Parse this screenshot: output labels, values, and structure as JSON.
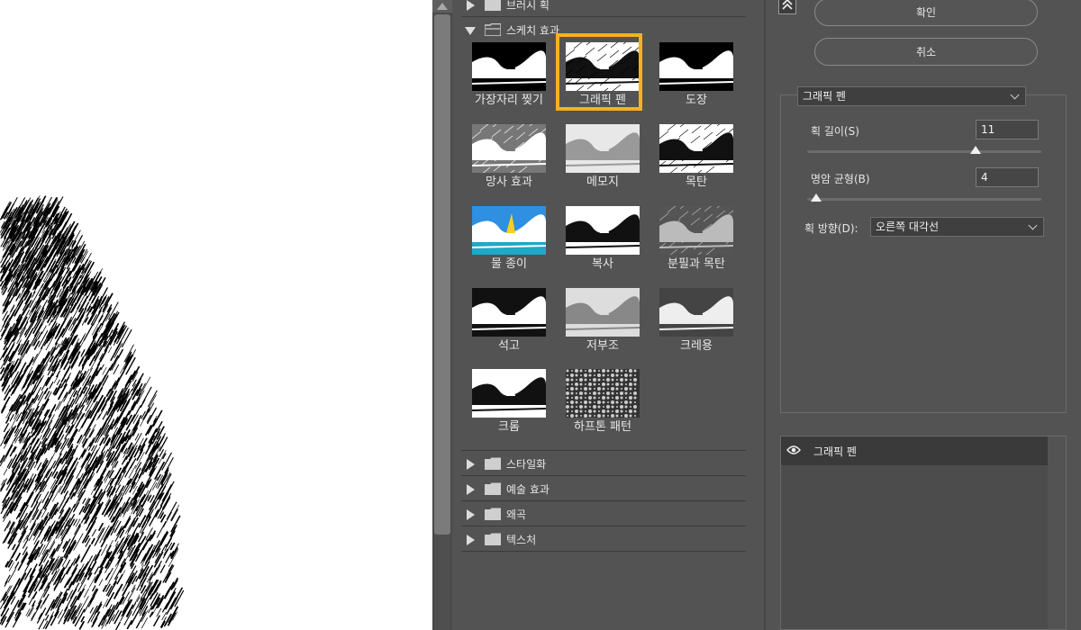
{
  "gallery": {
    "folders_top": [
      {
        "label": "브러시 획",
        "expanded": false
      }
    ],
    "current_folder": {
      "label": "스케치 효과",
      "expanded": true
    },
    "thumbnails": [
      {
        "label": "가장자리 찢기",
        "selected": false
      },
      {
        "label": "그래픽 펜",
        "selected": true
      },
      {
        "label": "도장",
        "selected": false
      },
      {
        "label": "망사 효과",
        "selected": false
      },
      {
        "label": "메모지",
        "selected": false
      },
      {
        "label": "목탄",
        "selected": false
      },
      {
        "label": "물 종이",
        "selected": false
      },
      {
        "label": "복사",
        "selected": false
      },
      {
        "label": "분필과 목탄",
        "selected": false
      },
      {
        "label": "석고",
        "selected": false
      },
      {
        "label": "저부조",
        "selected": false
      },
      {
        "label": "크레용",
        "selected": false
      },
      {
        "label": "크롬",
        "selected": false
      },
      {
        "label": "하프톤 패턴",
        "selected": false
      }
    ],
    "folders_bottom": [
      {
        "label": "스타일화",
        "expanded": false
      },
      {
        "label": "예술 효과",
        "expanded": false
      },
      {
        "label": "왜곡",
        "expanded": false
      },
      {
        "label": "텍스처",
        "expanded": false
      }
    ]
  },
  "settings": {
    "ok_label": "확인",
    "cancel_label": "취소",
    "filter_select": "그래픽 펜",
    "stroke_length": {
      "label": "획 길이(S)",
      "value": "11",
      "slider_fraction": 0.72
    },
    "light_dark_balance": {
      "label": "명암 균형(B)",
      "value": "4",
      "slider_fraction": 0.04
    },
    "stroke_direction": {
      "label": "획 방향(D):",
      "value": "오른쪽 대각선"
    }
  },
  "layers": {
    "items": [
      {
        "name": "그래픽 펜",
        "visible": true
      }
    ]
  },
  "colors": {
    "panel_bg": "#535353",
    "selection_outline": "#f5b21e",
    "preview_bg": "#ffffff"
  },
  "icons": {
    "collapse": "double-chevron-up-icon",
    "folder": "folder-icon",
    "eye": "eye-icon"
  }
}
